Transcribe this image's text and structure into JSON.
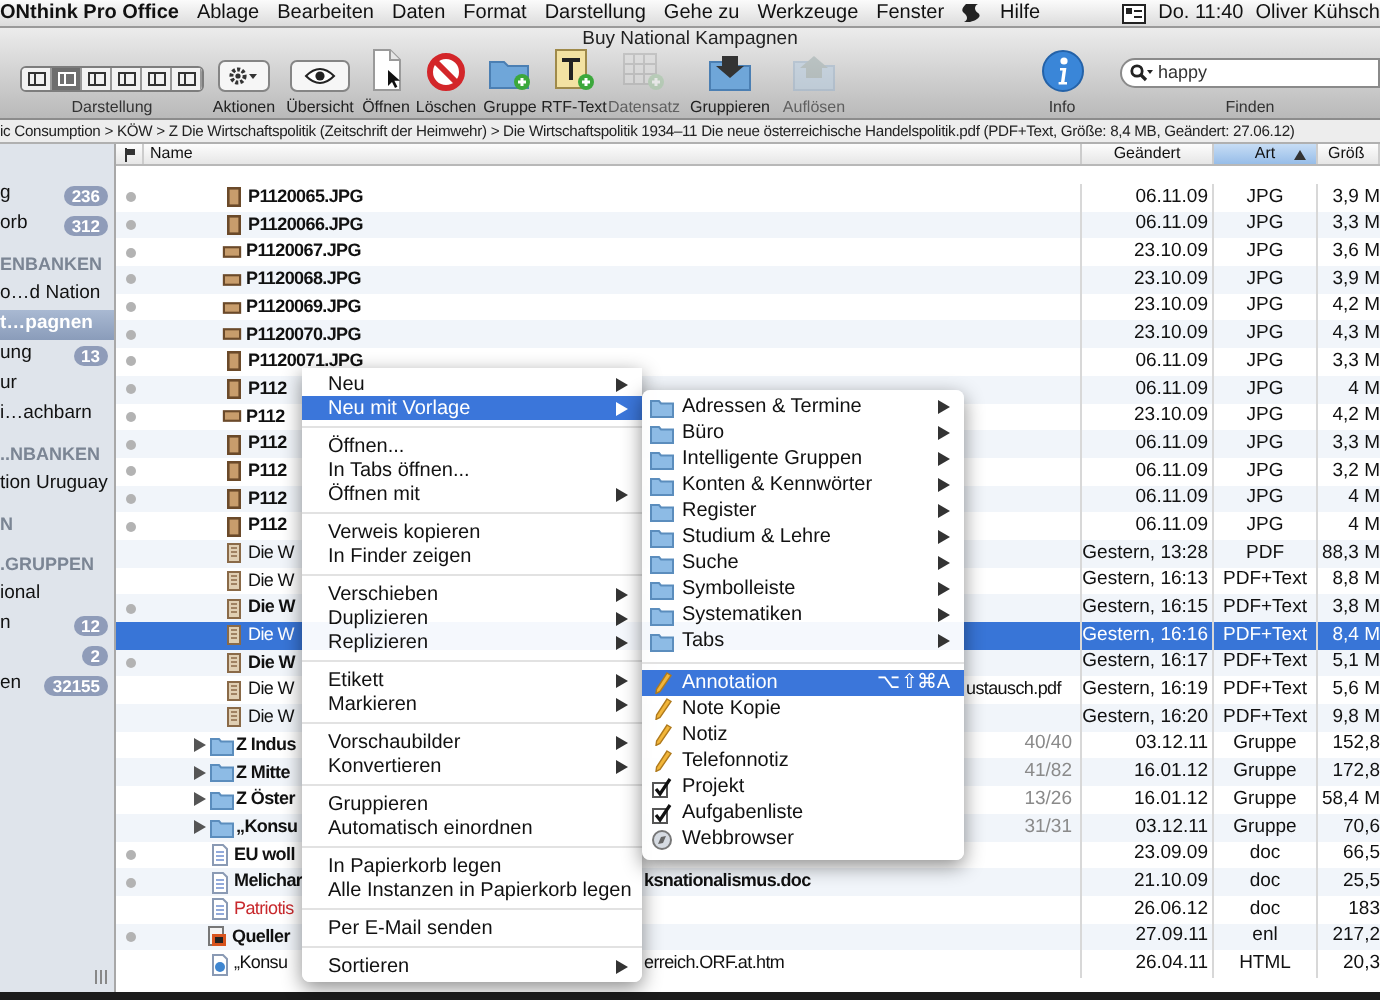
{
  "menubar": {
    "app": "ONthink Pro Office",
    "menus": [
      "Ablage",
      "Bearbeiten",
      "Daten",
      "Format",
      "Darstellung",
      "Gehe zu",
      "Werkzeuge",
      "Fenster"
    ],
    "help": "Hilfe",
    "clock": "Do. 11:40",
    "user": "Oliver Kühsch"
  },
  "window": {
    "title": "Buy National Kampagnen"
  },
  "toolbar": {
    "view_modes": [
      {
        "selected": false
      },
      {
        "selected": true
      },
      {
        "selected": false
      },
      {
        "selected": false
      },
      {
        "selected": false
      },
      {
        "selected": false
      }
    ],
    "view_label": "Darstellung",
    "buttons": [
      {
        "kind": "actions",
        "label": "Aktionen",
        "disabled": false
      },
      {
        "kind": "overview",
        "label": "Übersicht",
        "disabled": false
      },
      {
        "kind": "open",
        "label": "Öffnen",
        "disabled": false
      },
      {
        "kind": "delete",
        "label": "Löschen",
        "disabled": false
      },
      {
        "kind": "group",
        "label": "Gruppe",
        "disabled": false
      },
      {
        "kind": "rtf",
        "label": "RTF-Text",
        "disabled": false
      },
      {
        "kind": "record",
        "label": "Datensatz",
        "disabled": true
      },
      {
        "kind": "groupify",
        "label": "Gruppieren",
        "disabled": false
      },
      {
        "kind": "ungroup",
        "label": "Auflösen",
        "disabled": true
      }
    ],
    "info": {
      "label": "Info"
    },
    "search": {
      "value": "happy",
      "label": "Finden"
    }
  },
  "path": "ic Consumption > KÖW > Z Die Wirtschaftspolitik (Zeitschrift der Heimwehr) > Die Wirtschaftspolitik 1934–11 Die neue österreichische Handelspolitik.pdf (PDF+Text, Größe: 8,4 MB, Geändert: 27.06.12)",
  "sidebar": [
    {
      "kind": "item",
      "label": "g",
      "badge": "236",
      "selected": false
    },
    {
      "kind": "item",
      "label": "orb",
      "badge": "312",
      "selected": false
    },
    {
      "kind": "header",
      "label": "ENBANKEN"
    },
    {
      "kind": "item",
      "label": "o…d Nation",
      "selected": false
    },
    {
      "kind": "item",
      "label": "t…pagnen",
      "selected": true
    },
    {
      "kind": "item",
      "label": "ung",
      "badge": "13",
      "selected": false
    },
    {
      "kind": "item",
      "label": "ur",
      "selected": false
    },
    {
      "kind": "item",
      "label": "i…achbarn",
      "selected": false
    },
    {
      "kind": "header",
      "label": "..NBANKEN"
    },
    {
      "kind": "item",
      "label": "tion Uruguay",
      "selected": false
    },
    {
      "kind": "header",
      "label": "N"
    },
    {
      "kind": "header",
      "label": ".GRUPPEN"
    },
    {
      "kind": "item",
      "label": "ional",
      "selected": false
    },
    {
      "kind": "item",
      "label": "n",
      "badge": "12",
      "selected": false
    },
    {
      "kind": "item",
      "badge": "2",
      "selected": false
    },
    {
      "kind": "item",
      "label": "en",
      "badge": "32155",
      "selected": false
    }
  ],
  "table": {
    "columns": [
      {
        "label": "Name",
        "sorted": false
      },
      {
        "label": "Geändert",
        "sorted": false
      },
      {
        "label": "Art",
        "sorted": true
      },
      {
        "label": "Größ",
        "sorted": false
      }
    ],
    "rows": [
      {
        "kind": "photo",
        "name": "P1120065.JPG",
        "modified": "06.11.09",
        "type": "JPG",
        "size": "3,9 M",
        "unread": true,
        "selected": false
      },
      {
        "kind": "photo",
        "name": "P1120066.JPG",
        "modified": "06.11.09",
        "type": "JPG",
        "size": "3,3 M",
        "unread": true,
        "selected": false
      },
      {
        "kind": "photo_wide",
        "name": "P1120067.JPG",
        "modified": "23.10.09",
        "type": "JPG",
        "size": "3,6 M",
        "unread": true,
        "selected": false
      },
      {
        "kind": "photo_wide",
        "name": "P1120068.JPG",
        "modified": "23.10.09",
        "type": "JPG",
        "size": "3,9 M",
        "unread": true,
        "selected": false
      },
      {
        "kind": "photo_wide",
        "name": "P1120069.JPG",
        "modified": "23.10.09",
        "type": "JPG",
        "size": "4,2 M",
        "unread": true,
        "selected": false
      },
      {
        "kind": "photo_wide",
        "name": "P1120070.JPG",
        "modified": "23.10.09",
        "type": "JPG",
        "size": "4,3 M",
        "unread": true,
        "selected": false
      },
      {
        "kind": "photo",
        "name": "P1120071.JPG",
        "modified": "06.11.09",
        "type": "JPG",
        "size": "3,3 M",
        "unread": true,
        "selected": false
      },
      {
        "kind": "photo",
        "name": "P112",
        "modified": "06.11.09",
        "type": "JPG",
        "size": "4 M",
        "unread": true,
        "selected": false
      },
      {
        "kind": "photo_wide",
        "name": "P112",
        "modified": "23.10.09",
        "type": "JPG",
        "size": "4,2 M",
        "unread": true,
        "selected": false
      },
      {
        "kind": "photo",
        "name": "P112",
        "modified": "06.11.09",
        "type": "JPG",
        "size": "3,3 M",
        "unread": true,
        "selected": false
      },
      {
        "kind": "photo",
        "name": "P112",
        "modified": "06.11.09",
        "type": "JPG",
        "size": "3,2 M",
        "unread": true,
        "selected": false
      },
      {
        "kind": "photo",
        "name": "P112",
        "modified": "06.11.09",
        "type": "JPG",
        "size": "4 M",
        "unread": true,
        "selected": false
      },
      {
        "kind": "photo",
        "name": "P112",
        "modified": "06.11.09",
        "type": "JPG",
        "size": "4 M",
        "unread": true,
        "selected": false
      },
      {
        "kind": "pdf",
        "name": "Die W",
        "modified": "Gestern, 13:28",
        "type": "PDF",
        "size": "88,3 M",
        "unread": false,
        "selected": false
      },
      {
        "kind": "pdf",
        "name": "Die W",
        "modified": "Gestern, 16:13",
        "type": "PDF+Text",
        "size": "8,8 M",
        "unread": false,
        "selected": false
      },
      {
        "kind": "pdf",
        "name": "Die W",
        "modified": "Gestern, 16:15",
        "type": "PDF+Text",
        "size": "3,8 M",
        "unread": true,
        "selected": false
      },
      {
        "kind": "pdf",
        "name": "Die W",
        "modified": "Gestern, 16:16",
        "type": "PDF+Text",
        "size": "8,4 M",
        "unread": false,
        "selected": true
      },
      {
        "kind": "pdf",
        "name": "Die W",
        "modified": "Gestern, 16:17",
        "type": "PDF+Text",
        "size": "5,1 M",
        "unread": true,
        "selected": false
      },
      {
        "kind": "pdf",
        "name": "Die W",
        "name_end": "ustausch.pdf",
        "modified": "Gestern, 16:19",
        "type": "PDF+Text",
        "size": "5,6 M",
        "unread": false,
        "selected": false
      },
      {
        "kind": "pdf",
        "name": "Die W",
        "modified": "Gestern, 16:20",
        "type": "PDF+Text",
        "size": "9,8 M",
        "unread": false,
        "selected": false
      },
      {
        "kind": "folder",
        "expanded": false,
        "name": "Z Indus",
        "count": "40/40",
        "modified": "03.12.11",
        "type": "Gruppe",
        "size": "152,8",
        "unread": false,
        "selected": false
      },
      {
        "kind": "folder",
        "expanded": false,
        "name": "Z Mitte",
        "count": "41/82",
        "modified": "16.01.12",
        "type": "Gruppe",
        "size": "172,8",
        "unread": false,
        "selected": false
      },
      {
        "kind": "folder",
        "expanded": false,
        "name": "Z Öster",
        "count": "13/26",
        "modified": "16.01.12",
        "type": "Gruppe",
        "size": "58,4 M",
        "unread": false,
        "selected": false
      },
      {
        "kind": "folder",
        "expanded": false,
        "name": "„Konsu",
        "count": "31/31",
        "modified": "03.12.11",
        "type": "Gruppe",
        "size": "70,6",
        "unread": false,
        "selected": false
      },
      {
        "kind": "document",
        "name": "EU woll",
        "modified": "23.09.09",
        "type": "doc",
        "size": "66,5",
        "unread": true,
        "selected": false
      },
      {
        "kind": "document",
        "name": "Melichar",
        "tail": "ksnationalismus.doc",
        "modified": "21.10.09",
        "type": "doc",
        "size": "25,5",
        "unread": true,
        "selected": false
      },
      {
        "kind": "document",
        "name": "Patriotis",
        "color": "#c8282c",
        "modified": "26.06.12",
        "type": "doc",
        "size": "183",
        "unread": false,
        "selected": false
      },
      {
        "kind": "reference",
        "name": "Queller",
        "modified": "27.09.11",
        "type": "enl",
        "size": "217,2",
        "unread": true,
        "selected": false
      },
      {
        "kind": "webpage",
        "name": "„Konsu",
        "tail": "erreich.ORF.at.htm",
        "modified": "26.04.11",
        "type": "HTML",
        "size": "20,3",
        "unread": false,
        "selected": false
      }
    ]
  },
  "context_menu": [
    {
      "kind": "item",
      "label": "Neu",
      "submenu": true,
      "selected": false
    },
    {
      "kind": "item",
      "label": "Neu mit Vorlage",
      "submenu": true,
      "selected": true
    },
    {
      "kind": "separator"
    },
    {
      "kind": "item",
      "label": "Öffnen...",
      "submenu": false,
      "selected": false
    },
    {
      "kind": "item",
      "label": "In Tabs öffnen...",
      "submenu": false,
      "selected": false
    },
    {
      "kind": "item",
      "label": "Öffnen mit",
      "submenu": true,
      "selected": false
    },
    {
      "kind": "separator"
    },
    {
      "kind": "item",
      "label": "Verweis kopieren",
      "submenu": false,
      "selected": false
    },
    {
      "kind": "item",
      "label": "In Finder zeigen",
      "submenu": false,
      "selected": false
    },
    {
      "kind": "separator"
    },
    {
      "kind": "item",
      "label": "Verschieben",
      "submenu": true,
      "selected": false
    },
    {
      "kind": "item",
      "label": "Duplizieren",
      "submenu": true,
      "selected": false
    },
    {
      "kind": "item",
      "label": "Replizieren",
      "submenu": true,
      "selected": false
    },
    {
      "kind": "separator"
    },
    {
      "kind": "item",
      "label": "Etikett",
      "submenu": true,
      "selected": false
    },
    {
      "kind": "item",
      "label": "Markieren",
      "submenu": true,
      "selected": false
    },
    {
      "kind": "separator"
    },
    {
      "kind": "item",
      "label": "Vorschaubilder",
      "submenu": true,
      "selected": false
    },
    {
      "kind": "item",
      "label": "Konvertieren",
      "submenu": true,
      "selected": false
    },
    {
      "kind": "separator"
    },
    {
      "kind": "item",
      "label": "Gruppieren",
      "submenu": false,
      "selected": false
    },
    {
      "kind": "item",
      "label": "Automatisch einordnen",
      "submenu": false,
      "selected": false
    },
    {
      "kind": "separator"
    },
    {
      "kind": "item",
      "label": "In Papierkorb legen",
      "submenu": false,
      "selected": false
    },
    {
      "kind": "item",
      "label": "Alle Instanzen in Papierkorb legen",
      "submenu": false,
      "selected": false
    },
    {
      "kind": "separator"
    },
    {
      "kind": "item",
      "label": "Per E-Mail senden",
      "submenu": false,
      "selected": false
    },
    {
      "kind": "separator"
    },
    {
      "kind": "item",
      "label": "Sortieren",
      "submenu": true,
      "selected": false
    }
  ],
  "template_menu": [
    {
      "kind": "folder",
      "label": "Adressen & Termine",
      "submenu": true,
      "selected": false
    },
    {
      "kind": "folder",
      "label": "Büro",
      "submenu": true,
      "selected": false
    },
    {
      "kind": "folder",
      "label": "Intelligente Gruppen",
      "submenu": true,
      "selected": false
    },
    {
      "kind": "folder",
      "label": "Konten & Kennwörter",
      "submenu": true,
      "selected": false
    },
    {
      "kind": "folder",
      "label": "Register",
      "submenu": true,
      "selected": false
    },
    {
      "kind": "folder",
      "label": "Studium & Lehre",
      "submenu": true,
      "selected": false
    },
    {
      "kind": "folder",
      "label": "Suche",
      "submenu": true,
      "selected": false
    },
    {
      "kind": "folder",
      "label": "Symbolleiste",
      "submenu": true,
      "selected": false
    },
    {
      "kind": "folder",
      "label": "Systematiken",
      "submenu": true,
      "selected": false
    },
    {
      "kind": "folder",
      "label": "Tabs",
      "submenu": true,
      "selected": false
    },
    {
      "kind": "separator"
    },
    {
      "kind": "pencil",
      "label": "Annotation",
      "shortcut": "⌥⇧⌘A",
      "submenu": false,
      "selected": true
    },
    {
      "kind": "pencil",
      "label": "Note Kopie",
      "submenu": false,
      "selected": false
    },
    {
      "kind": "pencil",
      "label": "Notiz",
      "submenu": false,
      "selected": false
    },
    {
      "kind": "pencil",
      "label": "Telefonnotiz",
      "submenu": false,
      "selected": false
    },
    {
      "kind": "check",
      "label": "Projekt",
      "submenu": false,
      "selected": false
    },
    {
      "kind": "check",
      "label": "Aufgabenliste",
      "submenu": false,
      "selected": false
    },
    {
      "kind": "browser",
      "label": "Webbrowser",
      "submenu": false,
      "selected": false
    }
  ]
}
